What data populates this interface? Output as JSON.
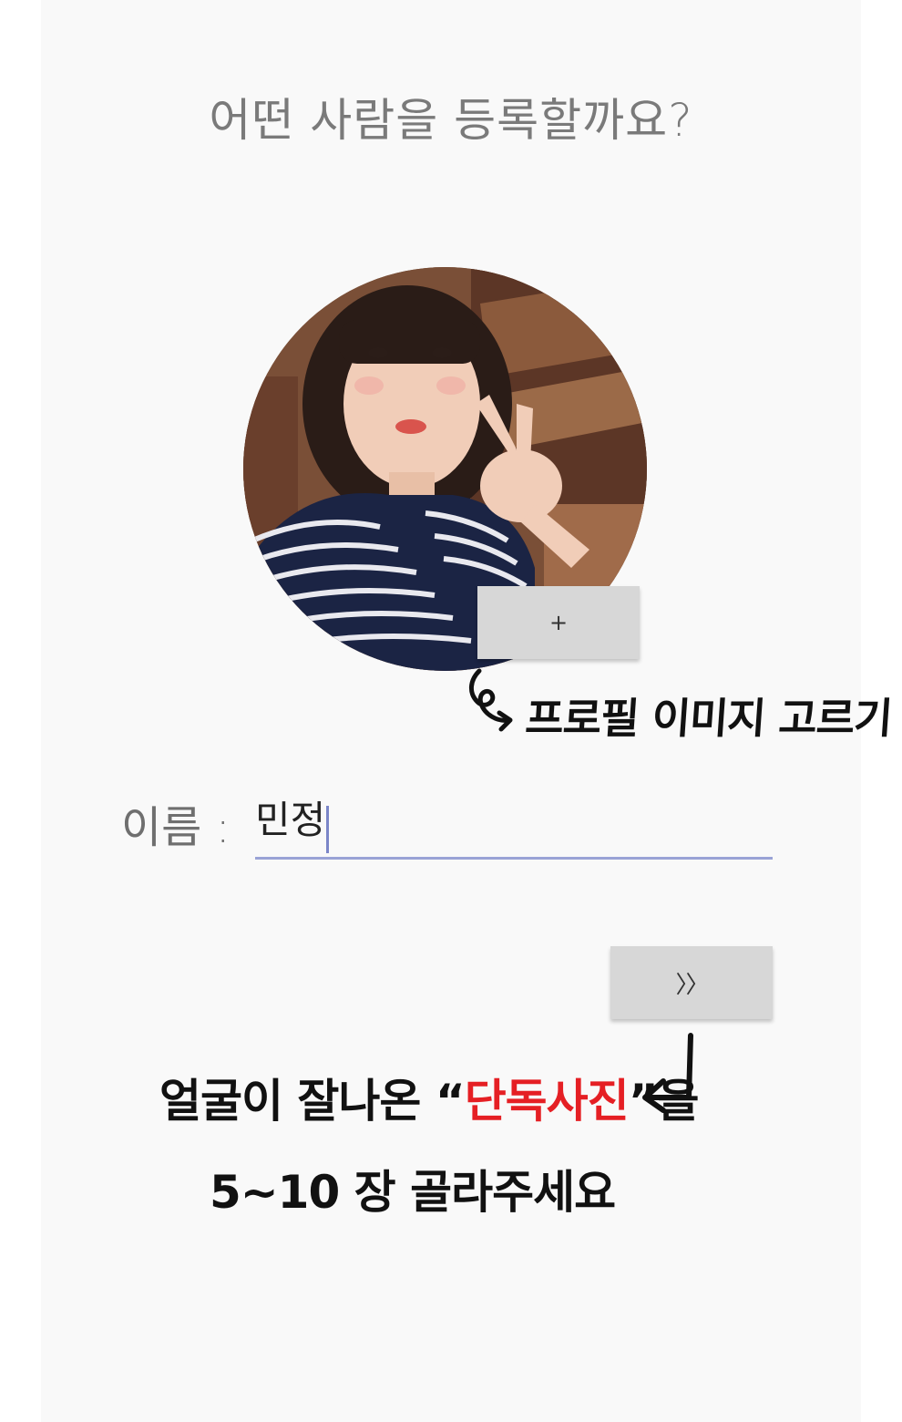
{
  "title": "어떤 사람을 등록할까요?",
  "profile": {
    "add_button_label": "+",
    "hint": "프로필 이미지 고르기"
  },
  "name": {
    "label": "이름 :",
    "value": "민정"
  },
  "next_button_label": "〉〉",
  "instructions": {
    "line1_prefix": "얼굴이 잘나온 “",
    "line1_emphasis": "단독사진",
    "line1_suffix": "”을",
    "line2": "5~10 장 골라주세요"
  },
  "colors": {
    "background": "#f9f9f9",
    "button": "#d7d7d7",
    "underline": "#9aa3d6",
    "emphasis": "#e51f24"
  }
}
